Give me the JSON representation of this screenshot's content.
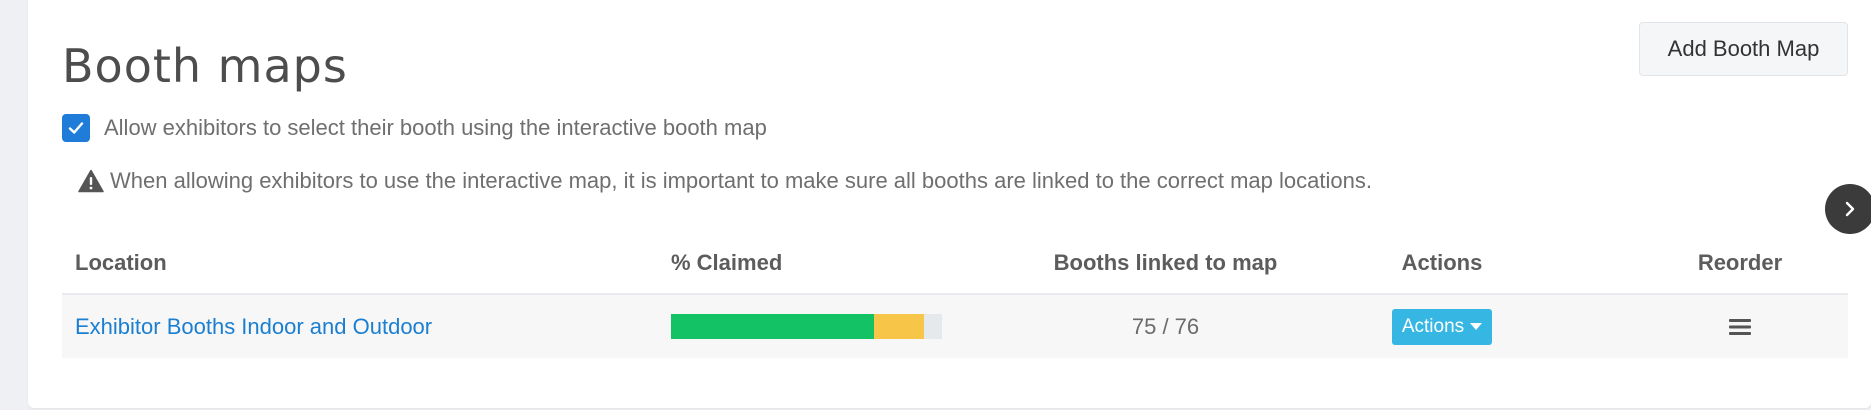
{
  "header": {
    "title": "Booth maps",
    "add_button_label": "Add Booth Map"
  },
  "settings": {
    "allow_exhibitors_checked": true,
    "allow_exhibitors_label": "Allow exhibitors to select their booth using the interactive booth map",
    "warning_icon": "warning-triangle-icon",
    "warning_text": "When allowing exhibitors to use the interactive map, it is important to make sure all booths are linked to the correct map locations."
  },
  "table": {
    "columns": [
      "Location",
      "% Claimed",
      "Booths linked to map",
      "Actions",
      "Reorder"
    ],
    "rows": [
      {
        "location": "Exhibitor Booths Indoor and Outdoor",
        "claimed": {
          "claimed_fraction": 0.75,
          "pending_fraction": 0.185,
          "claimed_color": "#13c265",
          "pending_color": "#f7c548",
          "track_color": "#e6e9ec"
        },
        "booths_linked": "75 / 76",
        "actions_label": "Actions",
        "reorder_icon": "hamburger-icon"
      }
    ]
  },
  "colors": {
    "link": "#1b7fd1",
    "checkbox": "#1f7cd8",
    "actions_button": "#35b6e3"
  },
  "navigation": {
    "next_icon": "chevron-right-icon"
  }
}
